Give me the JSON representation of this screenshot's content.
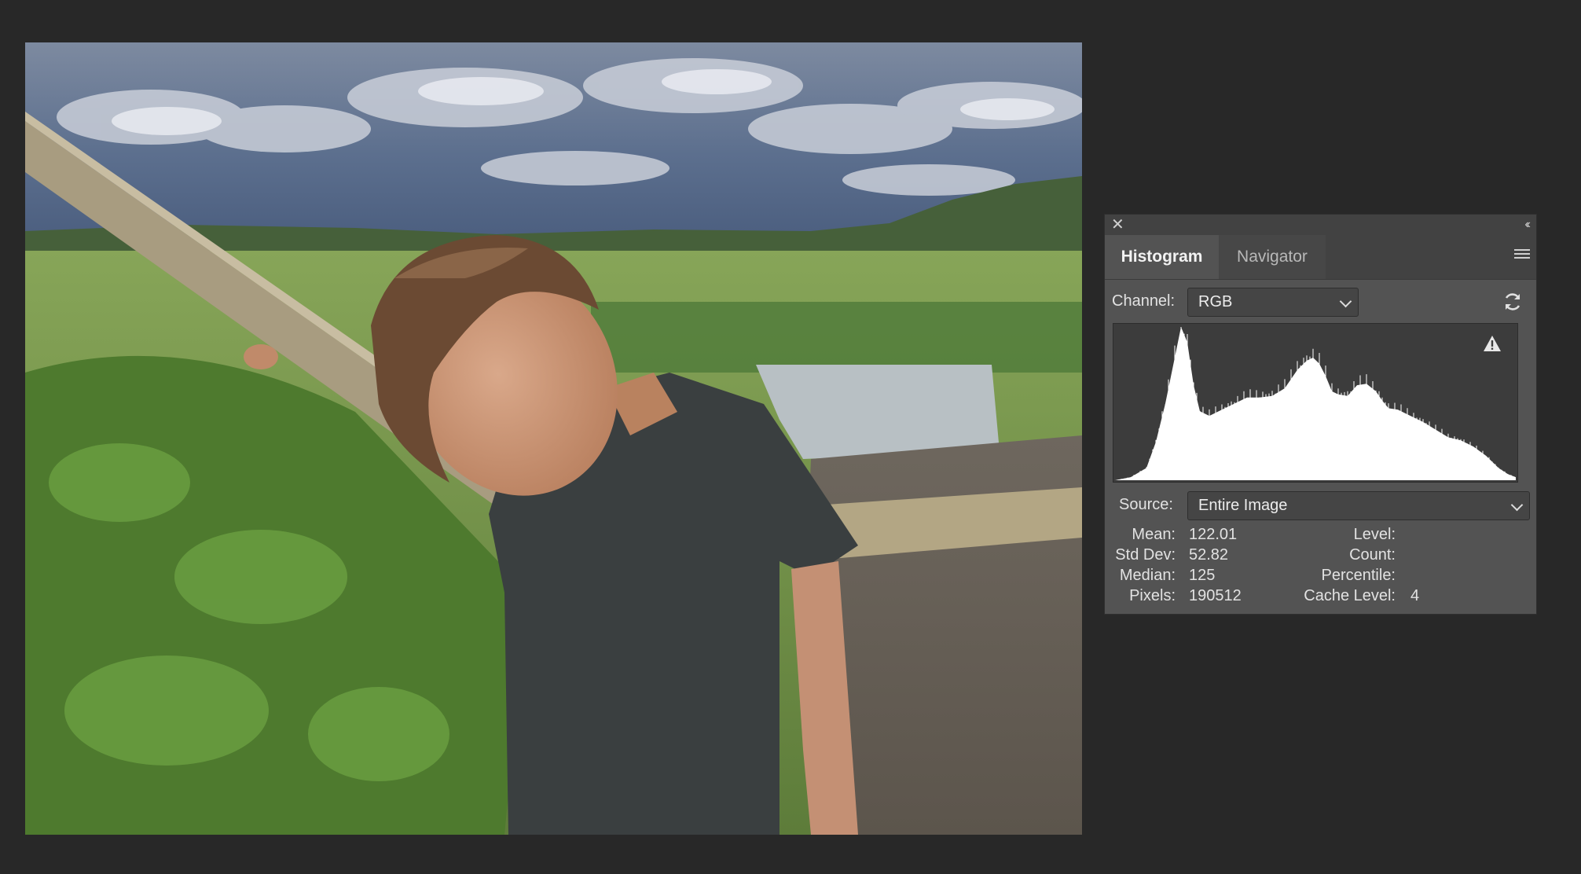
{
  "panel": {
    "tabs": [
      {
        "label": "Histogram",
        "active": true
      },
      {
        "label": "Navigator",
        "active": false
      }
    ],
    "icons": {
      "close": "close-icon",
      "collapse": "double-chevron-left-icon",
      "menu": "panel-menu-icon",
      "refresh": "refresh-icon",
      "warning": "warning-icon"
    },
    "channel": {
      "label": "Channel:",
      "value": "RGB"
    },
    "source": {
      "label": "Source:",
      "value": "Entire Image"
    },
    "stats": {
      "mean": {
        "label": "Mean:",
        "value": "122.01"
      },
      "std_dev": {
        "label": "Std Dev:",
        "value": "52.82"
      },
      "median": {
        "label": "Median:",
        "value": "125"
      },
      "pixels": {
        "label": "Pixels:",
        "value": "190512"
      },
      "level": {
        "label": "Level:",
        "value": ""
      },
      "count": {
        "label": "Count:",
        "value": ""
      },
      "percentile": {
        "label": "Percentile:",
        "value": ""
      },
      "cache_level": {
        "label": "Cache Level:",
        "value": "4"
      }
    }
  },
  "colors": {
    "app_background": "#282828",
    "panel_background": "#535353",
    "histogram_background": "#3c3c3c",
    "histogram_fill": "#ffffff"
  },
  "chart_data": {
    "type": "area",
    "xlim": [
      0,
      255
    ],
    "ylim": [
      0,
      1
    ],
    "x": [
      0,
      10,
      20,
      26,
      32,
      38,
      42,
      46,
      50,
      54,
      60,
      68,
      76,
      84,
      92,
      100,
      108,
      116,
      122,
      126,
      130,
      134,
      138,
      142,
      148,
      154,
      160,
      166,
      170,
      174,
      180,
      188,
      196,
      204,
      212,
      220,
      228,
      236,
      244,
      250,
      255
    ],
    "values": [
      0.0,
      0.02,
      0.08,
      0.25,
      0.5,
      0.8,
      1.0,
      0.9,
      0.62,
      0.45,
      0.42,
      0.46,
      0.5,
      0.54,
      0.54,
      0.55,
      0.6,
      0.72,
      0.78,
      0.8,
      0.76,
      0.68,
      0.58,
      0.56,
      0.55,
      0.62,
      0.63,
      0.58,
      0.52,
      0.47,
      0.46,
      0.42,
      0.38,
      0.33,
      0.28,
      0.26,
      0.22,
      0.16,
      0.08,
      0.04,
      0.02
    ]
  }
}
